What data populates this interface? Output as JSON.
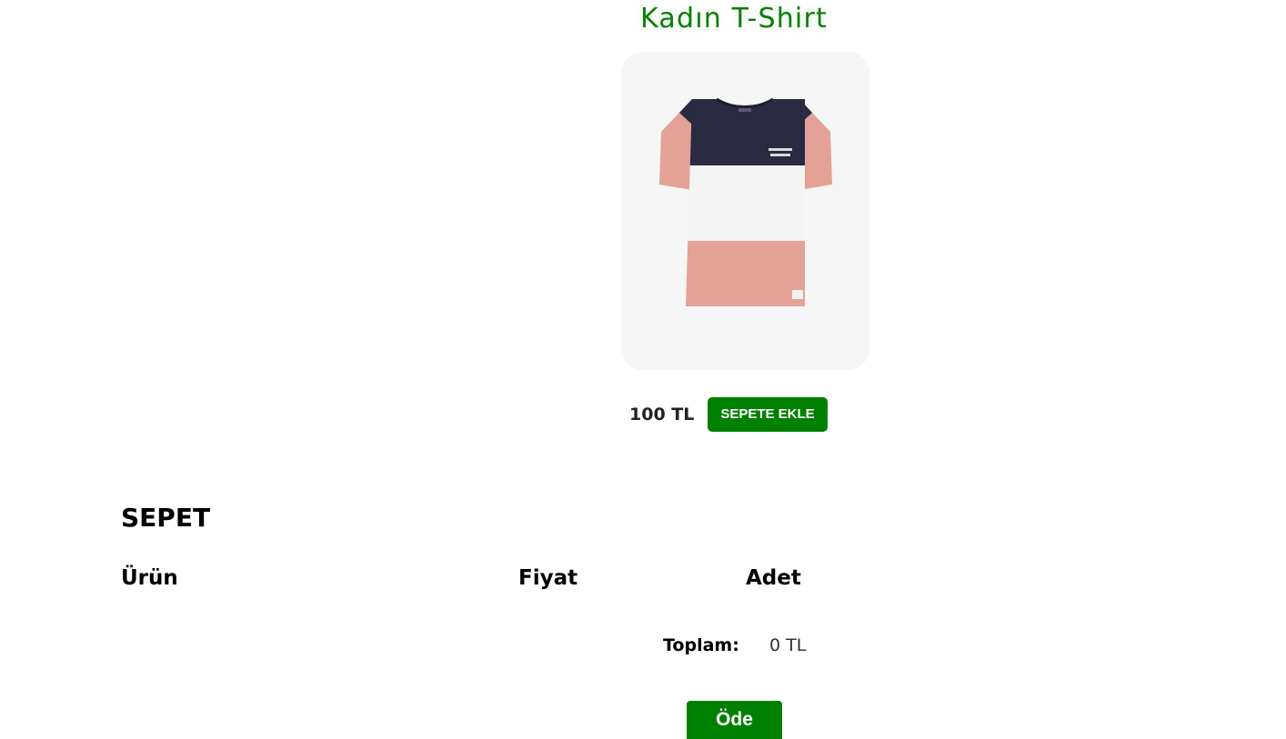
{
  "product": {
    "title": "Kadın T-Shirt",
    "image_icon": "tshirt-image",
    "price": "100 TL",
    "add_to_cart_label": "SEPETE EKLE"
  },
  "cart": {
    "title": "SEPET",
    "columns": {
      "product": "Ürün",
      "price": "Fiyat",
      "quantity": "Adet"
    },
    "items": [],
    "total_label": "Toplam:",
    "total_value": "0 TL",
    "pay_label": "Öde"
  },
  "colors": {
    "accent": "#008000",
    "title_green": "#0a7d0a",
    "card_background": "#f6f6f6"
  }
}
